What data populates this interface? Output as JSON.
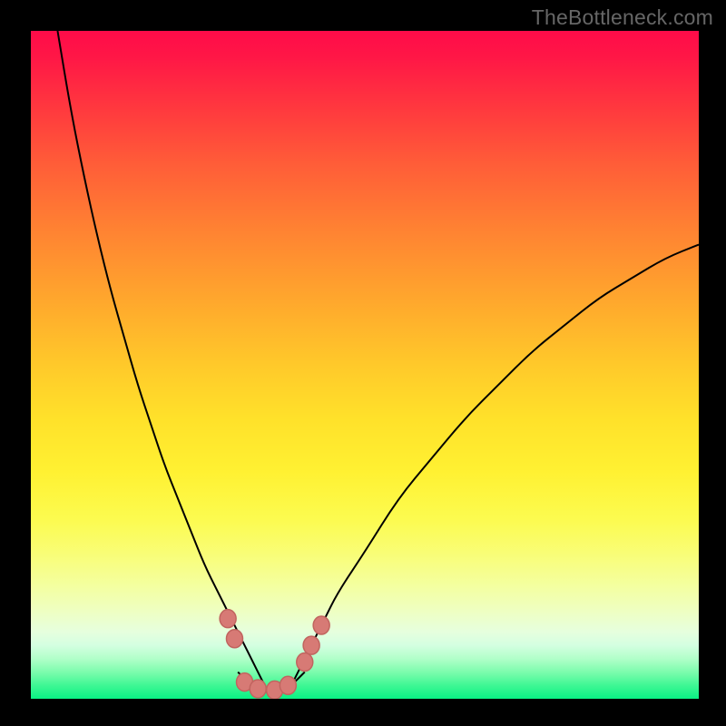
{
  "watermark": "TheBottleneck.com",
  "colors": {
    "page_bg": "#000000",
    "gradient_top": "#ff0b49",
    "gradient_bottom": "#09f184",
    "curve_stroke": "#000000",
    "marker_fill": "#d77a75",
    "marker_stroke": "#c1645f",
    "watermark_text": "#666666"
  },
  "chart_data": {
    "type": "line",
    "title": "",
    "xlabel": "",
    "ylabel": "",
    "xlim": [
      0,
      100
    ],
    "ylim": [
      0,
      100
    ],
    "grid": false,
    "legend": false,
    "series": [
      {
        "name": "left-curve",
        "x": [
          4,
          6,
          8,
          10,
          12,
          14,
          16,
          18,
          20,
          22,
          24,
          26,
          28,
          30,
          31,
          32,
          33,
          34,
          35
        ],
        "y": [
          100,
          88,
          78,
          69,
          61,
          54,
          47,
          41,
          35,
          30,
          25,
          20,
          16,
          12,
          10,
          8,
          6,
          4,
          2
        ]
      },
      {
        "name": "right-curve",
        "x": [
          39,
          40,
          42,
          44,
          46,
          50,
          55,
          60,
          65,
          70,
          75,
          80,
          85,
          90,
          95,
          100
        ],
        "y": [
          2,
          4,
          8,
          12,
          16,
          22,
          30,
          36,
          42,
          47,
          52,
          56,
          60,
          63,
          66,
          68
        ]
      },
      {
        "name": "valley-floor",
        "x": [
          31,
          32,
          33,
          34,
          35,
          36,
          37,
          38,
          39,
          40,
          41
        ],
        "y": [
          4,
          3,
          2,
          1.5,
          1,
          1,
          1,
          1.5,
          2,
          3,
          4
        ]
      }
    ],
    "markers": [
      {
        "name": "left-upper",
        "x": 29.5,
        "y": 12
      },
      {
        "name": "left-lower",
        "x": 30.5,
        "y": 9
      },
      {
        "name": "floor-1",
        "x": 32.0,
        "y": 2.5
      },
      {
        "name": "floor-2",
        "x": 34.0,
        "y": 1.5
      },
      {
        "name": "floor-3",
        "x": 36.5,
        "y": 1.3
      },
      {
        "name": "floor-4",
        "x": 38.5,
        "y": 2.0
      },
      {
        "name": "right-lower",
        "x": 41.0,
        "y": 5.5
      },
      {
        "name": "right-mid",
        "x": 42.0,
        "y": 8
      },
      {
        "name": "right-upper",
        "x": 43.5,
        "y": 11
      }
    ]
  }
}
